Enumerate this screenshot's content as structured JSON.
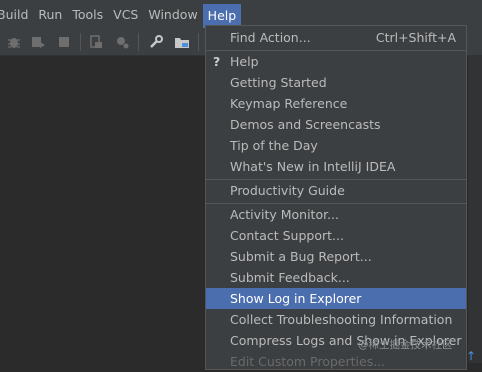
{
  "menubar": {
    "items": [
      {
        "label": "Build"
      },
      {
        "label": "Run"
      },
      {
        "label": "Tools"
      },
      {
        "label": "VCS"
      },
      {
        "label": "Window"
      },
      {
        "label": "Help",
        "active": true
      }
    ]
  },
  "toolbar": {
    "icons": [
      "bug-icon",
      "coverage-icon",
      "stop-icon",
      "build-artifacts-icon",
      "settings-gear-icon",
      "wrench-icon",
      "project-structure-icon"
    ]
  },
  "help_menu": {
    "items": [
      {
        "label": "Find Action...",
        "shortcut": "Ctrl+Shift+A"
      },
      {
        "label": "Help",
        "icon": "?"
      },
      {
        "label": "Getting Started"
      },
      {
        "label": "Keymap Reference"
      },
      {
        "label": "Demos and Screencasts"
      },
      {
        "label": "Tip of the Day"
      },
      {
        "label": "What's New in IntelliJ IDEA"
      },
      {
        "label": "Productivity Guide"
      },
      {
        "label": "Activity Monitor..."
      },
      {
        "label": "Contact Support..."
      },
      {
        "label": "Submit a Bug Report..."
      },
      {
        "label": "Submit Feedback..."
      },
      {
        "label": "Show Log in Explorer",
        "selected": true
      },
      {
        "label": "Collect Troubleshooting Information"
      },
      {
        "label": "Compress Logs and Show in Explorer"
      },
      {
        "label": "Edit Custom Properties..."
      }
    ]
  },
  "watermark": "@稀土掘金技术社区",
  "colors": {
    "menubar_bg": "#3c3f41",
    "editor_bg": "#2b2b2b",
    "selection": "#4b6eaf",
    "text": "#bbbbbb"
  }
}
